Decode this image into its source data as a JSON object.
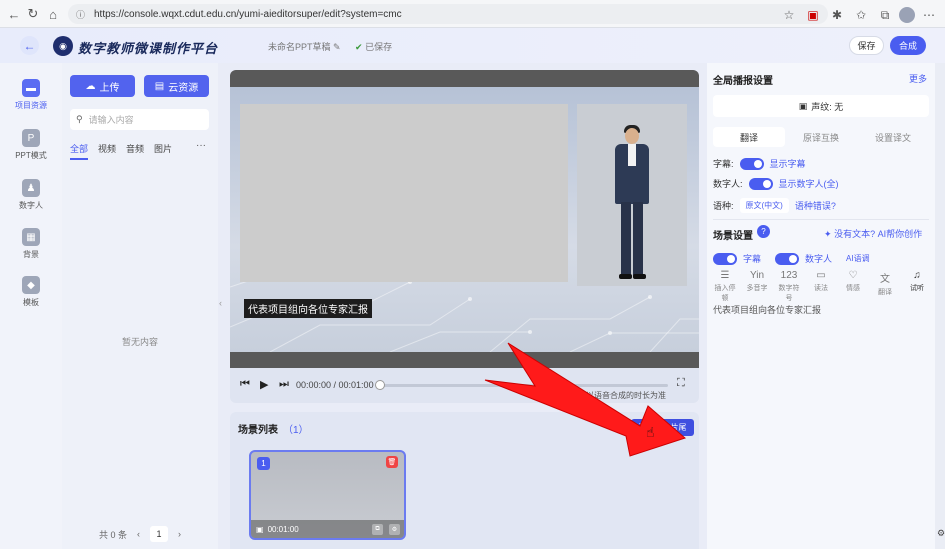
{
  "browser": {
    "url": "https://console.wqxt.cdut.edu.cn/yumi-aieditorsuper/edit?system=cmc",
    "icons": [
      "back-icon",
      "forward-icon",
      "reload-icon",
      "home-icon",
      "info-icon",
      "star-icon",
      "extension-icon",
      "puzzle-icon",
      "favorites-icon",
      "profile-icon",
      "menu-icon"
    ]
  },
  "header": {
    "app_title": "数字教师微课制作平台",
    "doc_title": "未命名PPT草稿",
    "save_status": "已保存",
    "save_label": "保存",
    "synthesize_label": "合成"
  },
  "leftnav": {
    "items": [
      {
        "label": "项目资源",
        "icon": "folder-icon",
        "active": true
      },
      {
        "label": "PPT模式",
        "icon": "ppt-icon",
        "active": false
      },
      {
        "label": "数字人",
        "icon": "person-icon",
        "active": false
      },
      {
        "label": "背景",
        "icon": "image-icon",
        "active": false
      },
      {
        "label": "模板",
        "icon": "cube-icon",
        "active": false
      }
    ]
  },
  "assets": {
    "upload_label": "上传",
    "cloud_label": "云资源",
    "search_placeholder": "请输入内容",
    "tabs": [
      "全部",
      "视频",
      "音频",
      "图片"
    ],
    "more": "···",
    "empty_text": "暂无内容",
    "pager": {
      "total": "共 0 条",
      "prev": "‹",
      "page": "1",
      "next": "›"
    }
  },
  "player": {
    "subtitle": "代表项目组向各位专家汇报",
    "time": "00:00:00 / 00:01:00",
    "progress": 0,
    "hint": "时长以语音合成的时长为准"
  },
  "scenes": {
    "title": "场景列表",
    "count": "（1）",
    "headtail_label": "添加片头片尾",
    "cards": [
      {
        "number": "1",
        "duration": "00:01:00"
      }
    ]
  },
  "right": {
    "global_title": "全局播报设置",
    "more_label": "更多",
    "voice_label": "声纹: 无",
    "tabs": [
      "翻译",
      "原译互换",
      "设置译文"
    ],
    "subtitle_label": "字幕:",
    "subtitle_toggle_text": "显示字幕",
    "avatar_label": "数字人:",
    "avatar_toggle_text": "显示数字人(全)",
    "lang_label": "语种:",
    "lang_value": "原文(中文)",
    "lang_error": "语种错误?",
    "scene_title": "场景设置",
    "ai_help": "没有文本? AI帮你创作",
    "scene_subtitle": "字幕",
    "scene_avatar": "数字人",
    "ai_voice": "AI语调",
    "tools": [
      {
        "glyph": "☰",
        "label": "插入停顿"
      },
      {
        "glyph": "Yin",
        "label": "多音字"
      },
      {
        "glyph": "123",
        "label": "数字符号"
      },
      {
        "glyph": "▭",
        "label": "读法"
      },
      {
        "glyph": "♡",
        "label": "情感"
      },
      {
        "glyph": "文",
        "label": "翻译"
      },
      {
        "glyph": "♫",
        "label": "试听"
      }
    ],
    "script_text": "代表项目组向各位专家汇报"
  },
  "colors": {
    "accent": "#4a5df0",
    "delete": "#ef4444",
    "arrow": "#ff1a1a"
  }
}
